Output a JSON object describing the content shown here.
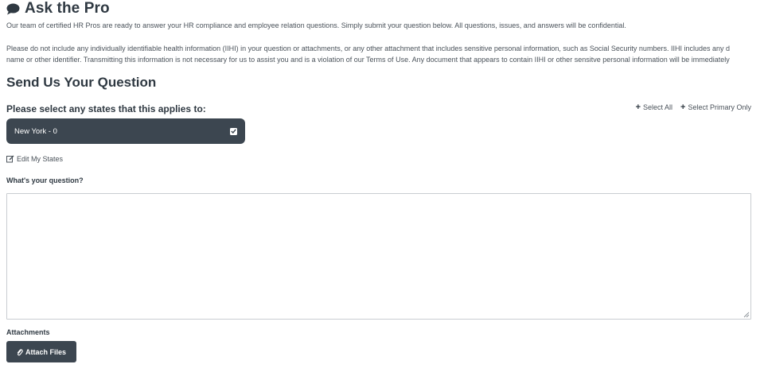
{
  "header": {
    "title": "Ask the Pro",
    "intro": "Our team of certified HR Pros are ready to answer your HR compliance and employee relation questions. Simply submit your question below. All questions, issues, and answers will be confidential.",
    "privacy_line1": "Please do not include any individually identifiable health information (IIHI) in your question or attachments, or any other attachment that includes sensitive personal information, such as Social Security numbers. IIHI includes any d",
    "privacy_line2": "name or other identifier. Transmitting this information is not necessary for us to assist you and is a violation of our Terms of Use. Any document that appears to contain IIHI or other sensitve personal information will be immediately"
  },
  "form": {
    "heading": "Send Us Your Question",
    "states_label": "Please select any states that this applies to:",
    "select_all": "Select All",
    "select_primary_only": "Select Primary Only",
    "states": [
      {
        "label": "New York - 0",
        "checked": true
      }
    ],
    "edit_states": "Edit My States",
    "question_label": "What's your question?",
    "question_value": "",
    "attachments_label": "Attachments",
    "attach_button": "Attach Files"
  },
  "icons": {
    "title_icon": "comment-icon",
    "plus_icon": "plus-icon",
    "check_icon": "checkbox-checked-icon",
    "edit_icon": "edit-icon",
    "attach_icon": "paperclip-icon"
  },
  "colors": {
    "primary_dark": "#3c4650",
    "heading_text": "#2f3942",
    "body_text": "#4a525a",
    "border": "#c9cdd1"
  }
}
